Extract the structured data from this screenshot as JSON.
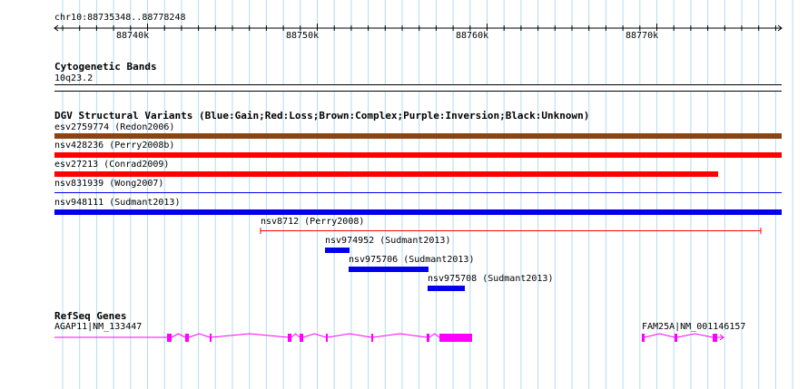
{
  "ruler": {
    "region": "chr10:88735348..88778248",
    "ticks": [
      "88740k",
      "88750k",
      "88760k",
      "88770k"
    ]
  },
  "cytoband": {
    "title": "Cytogenetic Bands",
    "band": "10q23.2"
  },
  "dgv": {
    "title": "DGV Structural Variants (Blue:Gain;Red:Loss;Brown:Complex;Purple:Inversion;Black:Unknown)",
    "colors": {
      "gain": "#0000ee",
      "loss": "#ff0000",
      "complex": "#8b4513",
      "unknown": "#000000"
    },
    "variants": [
      {
        "label": "esv2759774 (Redon2006)",
        "type": "complex"
      },
      {
        "label": "nsv428236 (Perry2008b)",
        "type": "loss"
      },
      {
        "label": "esv27213 (Conrad2009)",
        "type": "loss"
      },
      {
        "label": "nsv831939 (Wong2007)",
        "type": "gain"
      },
      {
        "label": "nsv948111 (Sudmant2013)",
        "type": "gain"
      },
      {
        "label": "nsv8712 (Perry2008)",
        "type": "loss"
      },
      {
        "label": "nsv974952 (Sudmant2013)",
        "type": "gain"
      },
      {
        "label": "nsv975706 (Sudmant2013)",
        "type": "gain"
      },
      {
        "label": "nsv975708 (Sudmant2013)",
        "type": "gain"
      }
    ]
  },
  "refseq": {
    "title": "RefSeq Genes",
    "gene_color": "#ff00ff",
    "genes": [
      {
        "label": "AGAP11|NM_133447"
      },
      {
        "label": "FAM25A|NM_001146157"
      }
    ]
  },
  "grid_color": "#b3dcec"
}
